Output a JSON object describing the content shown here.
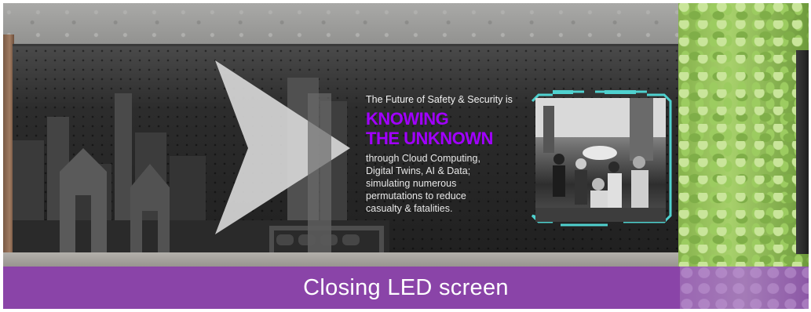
{
  "screen": {
    "kicker": "The Future of Safety & Security is",
    "headline_lines": [
      "KNOWING",
      "THE UNKNOWN"
    ],
    "body_lines": [
      "through Cloud Computing,",
      "Digital Twins, AI & Data;",
      "simulating numerous",
      "permutations to reduce",
      "casualty & fatalities."
    ],
    "accent_color": "#a100ff",
    "frame_color": "#4fd1cf"
  },
  "caption": {
    "text": "Closing LED screen",
    "background_color": "#8a44a8"
  }
}
